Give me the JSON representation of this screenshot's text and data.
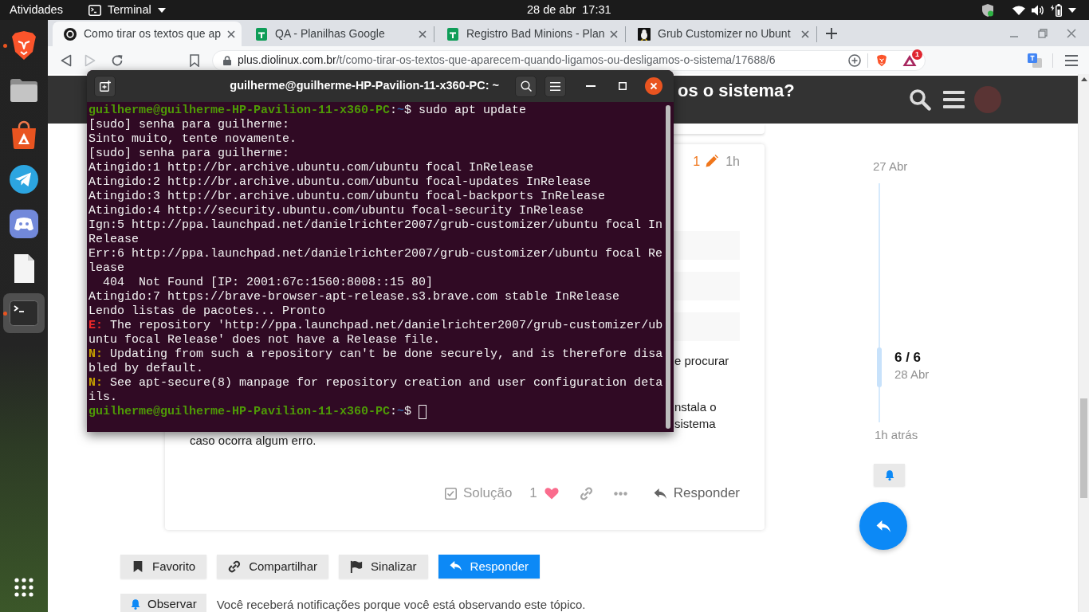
{
  "top_bar": {
    "activities": "Atividades",
    "app_menu": "Terminal",
    "date": "28 de abr",
    "time": "17:31"
  },
  "dock": {
    "items": [
      {
        "kind": "browser",
        "running": true,
        "focused": false
      },
      {
        "kind": "files",
        "running": false,
        "focused": false
      },
      {
        "kind": "store",
        "running": false,
        "focused": false
      },
      {
        "kind": "messenger",
        "running": false,
        "focused": false
      },
      {
        "kind": "chat",
        "running": false,
        "focused": false
      },
      {
        "kind": "document",
        "running": false,
        "focused": false
      },
      {
        "kind": "terminal",
        "running": true,
        "focused": true
      }
    ]
  },
  "browser": {
    "tabs": [
      {
        "kind": "forum",
        "title": "Como tirar os textos que ap",
        "selected": true
      },
      {
        "kind": "sheet",
        "title": "QA - Planilhas Google",
        "selected": false
      },
      {
        "kind": "sheet",
        "title": "Registro Bad Minions - Plan",
        "selected": false
      },
      {
        "kind": "linux",
        "title": "Grub Customizer no Ubunt",
        "selected": false
      }
    ],
    "toolbar": {
      "back_disabled": false,
      "forward_disabled": true
    },
    "address": {
      "host": "plus.diolinux.com.br",
      "path": "/t/como-tirar-os-textos-que-aparecem-quando-ligamos-ou-desligamos-o-sistema/17688/6"
    },
    "rewards_badge": "1"
  },
  "page": {
    "header": {
      "title": "os o sistema?"
    },
    "post": {
      "edit_count": "1",
      "age": "1h",
      "paragraphs": [
        {
          "lines": [
            {
              "kind": "tail",
              "text": "e procurar"
            }
          ]
        },
        {
          "lines": [
            {
              "kind": "tail",
              "text": "nstala o"
            },
            {
              "kind": "tail",
              "text": "sistema"
            },
            {
              "kind": "full",
              "text": "caso ocorra algum erro."
            }
          ]
        }
      ],
      "actions": {
        "solution": "Solução",
        "likes": "1",
        "reply": "Responder"
      }
    },
    "topic_buttons": [
      {
        "kind": "bookmark",
        "label": "Favorito",
        "primary": false
      },
      {
        "kind": "share",
        "label": "Compartilhar",
        "primary": false
      },
      {
        "kind": "flag",
        "label": "Sinalizar",
        "primary": false
      },
      {
        "kind": "reply",
        "label": "Responder",
        "primary": true
      }
    ],
    "notifications": {
      "button": "Observar",
      "text": "Você receberá notificações porque você está observando este tópico."
    },
    "timeline": {
      "start": "27 Abr",
      "counter": "6 / 6",
      "date": "28 Abr",
      "end": "1h atrás"
    }
  },
  "terminal": {
    "title": "guilherme@guilherme-HP-Pavilion-11-x360-PC: ~",
    "lines": [
      {
        "segments": [
          {
            "kind": "host",
            "text": "guilherme@guilherme-HP-Pavilion-11-x360-PC"
          },
          {
            "kind": "plain",
            "text": ":"
          },
          {
            "kind": "path",
            "text": "~"
          },
          {
            "kind": "plain",
            "text": "$ sudo apt update"
          }
        ]
      },
      {
        "segments": [
          {
            "kind": "plain",
            "text": "[sudo] senha para guilherme:"
          }
        ]
      },
      {
        "segments": [
          {
            "kind": "plain",
            "text": "Sinto muito, tente novamente."
          }
        ]
      },
      {
        "segments": [
          {
            "kind": "plain",
            "text": "[sudo] senha para guilherme:"
          }
        ]
      },
      {
        "segments": [
          {
            "kind": "plain",
            "text": "Atingido:1 http://br.archive.ubuntu.com/ubuntu focal InRelease"
          }
        ]
      },
      {
        "segments": [
          {
            "kind": "plain",
            "text": "Atingido:2 http://br.archive.ubuntu.com/ubuntu focal-updates InRelease"
          }
        ]
      },
      {
        "segments": [
          {
            "kind": "plain",
            "text": "Atingido:3 http://br.archive.ubuntu.com/ubuntu focal-backports InRelease"
          }
        ]
      },
      {
        "segments": [
          {
            "kind": "plain",
            "text": "Atingido:4 http://security.ubuntu.com/ubuntu focal-security InRelease"
          }
        ]
      },
      {
        "segments": [
          {
            "kind": "plain",
            "text": "Ign:5 http://ppa.launchpad.net/danielrichter2007/grub-customizer/ubuntu focal In"
          }
        ]
      },
      {
        "segments": [
          {
            "kind": "plain",
            "text": "Release"
          }
        ]
      },
      {
        "segments": [
          {
            "kind": "plain",
            "text": "Err:6 http://ppa.launchpad.net/danielrichter2007/grub-customizer/ubuntu focal Re"
          }
        ]
      },
      {
        "segments": [
          {
            "kind": "plain",
            "text": "lease"
          }
        ]
      },
      {
        "segments": [
          {
            "kind": "plain",
            "text": "  404  Not Found [IP: 2001:67c:1560:8008::15 80]"
          }
        ]
      },
      {
        "segments": [
          {
            "kind": "plain",
            "text": "Atingido:7 https://brave-browser-apt-release.s3.brave.com stable InRelease"
          }
        ]
      },
      {
        "segments": [
          {
            "kind": "plain",
            "text": "Lendo listas de pacotes... Pronto"
          }
        ]
      },
      {
        "segments": [
          {
            "kind": "error",
            "text": "E:"
          },
          {
            "kind": "plain",
            "text": " The repository 'http://ppa.launchpad.net/danielrichter2007/grub-customizer/ub"
          }
        ]
      },
      {
        "segments": [
          {
            "kind": "plain",
            "text": "untu focal Release' does not have a Release file."
          }
        ]
      },
      {
        "segments": [
          {
            "kind": "note",
            "text": "N:"
          },
          {
            "kind": "plain",
            "text": " Updating from such a repository can't be done securely, and is therefore disa"
          }
        ]
      },
      {
        "segments": [
          {
            "kind": "plain",
            "text": "bled by default."
          }
        ]
      },
      {
        "segments": [
          {
            "kind": "note",
            "text": "N:"
          },
          {
            "kind": "plain",
            "text": " See apt-secure(8) manpage for repository creation and user configuration deta"
          }
        ]
      },
      {
        "segments": [
          {
            "kind": "plain",
            "text": "ils."
          }
        ]
      },
      {
        "segments": [
          {
            "kind": "host",
            "text": "guilherme@guilherme-HP-Pavilion-11-x360-PC"
          },
          {
            "kind": "plain",
            "text": ":"
          },
          {
            "kind": "path",
            "text": "~"
          },
          {
            "kind": "plain",
            "text": "$"
          }
        ]
      }
    ]
  }
}
